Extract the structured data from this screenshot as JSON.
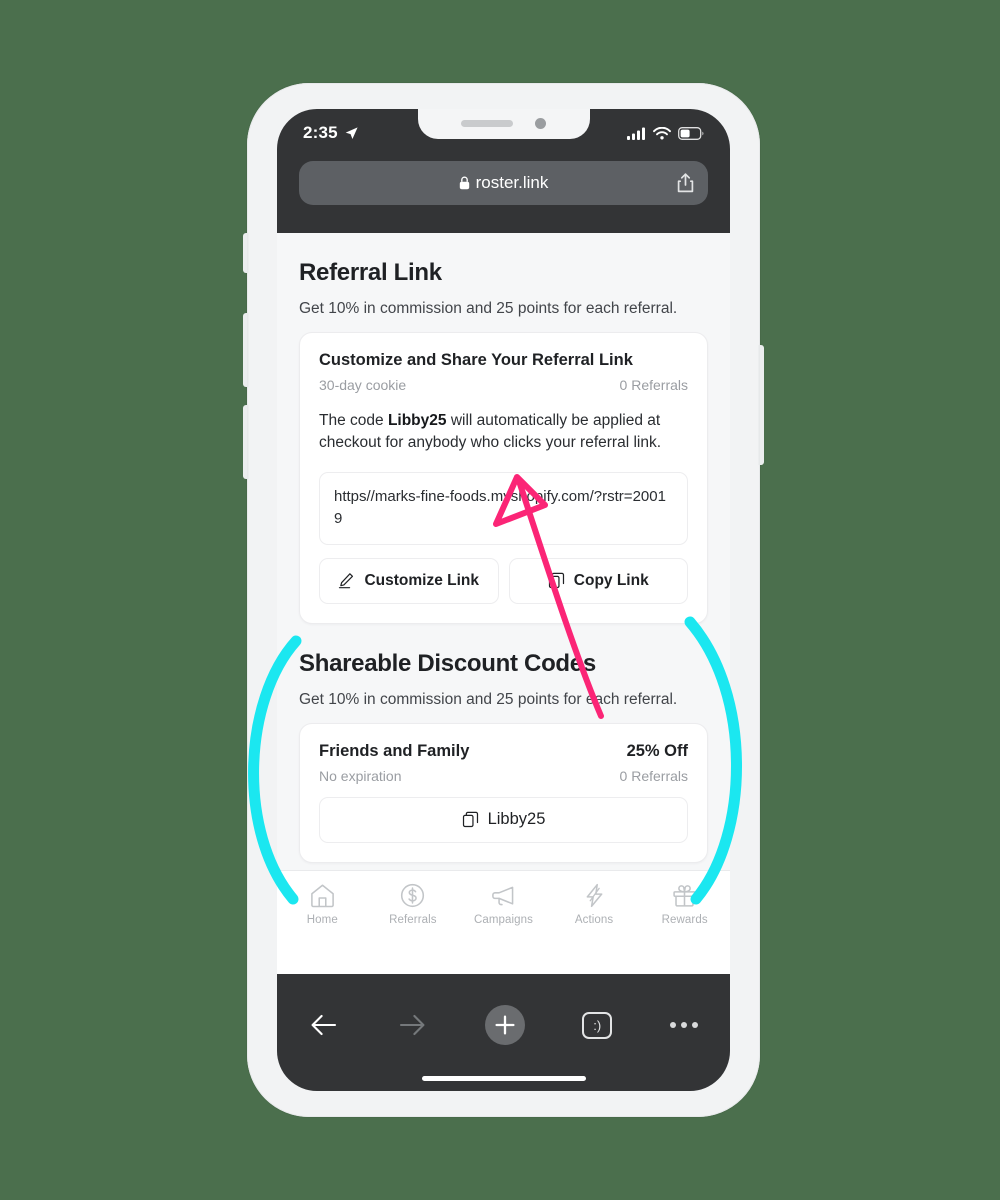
{
  "device": {
    "status_bar": {
      "time": "2:35",
      "location_icon": "location-arrow-icon",
      "signal_icon": "cellular-signal-icon",
      "wifi_icon": "wifi-icon",
      "battery_icon": "battery-icon"
    },
    "url_bar": {
      "lock_icon": "lock-icon",
      "domain": "roster.link",
      "share_icon": "share-icon"
    },
    "browser_toolbar": {
      "back_icon": "back-arrow-icon",
      "forward_icon": "forward-arrow-icon",
      "new_tab_icon": "plus-icon",
      "tabs_icon": "smiley-tab-icon",
      "tabs_label": ":)",
      "more_icon": "more-dots-icon"
    }
  },
  "page": {
    "referral_link": {
      "title": "Referral Link",
      "subtitle": "Get 10% in commission and 25 points for each referral.",
      "card": {
        "title": "Customize and Share Your Referral Link",
        "cookie": "30-day cookie",
        "referrals": "0 Referrals",
        "body_prefix": "The code ",
        "body_code": "Libby25",
        "body_suffix": " will automatically be applied at checkout for anybody who clicks your referral link.",
        "url": "https//marks-fine-foods.myshopify.com/?rstr=20019",
        "customize_button": "Customize Link",
        "customize_icon": "pencil-edit-icon",
        "copy_button": "Copy Link",
        "copy_icon": "copy-icon"
      }
    },
    "discount_codes": {
      "title": "Shareable Discount Codes",
      "subtitle": "Get 10% in commission and 25 points for each referral.",
      "card": {
        "name": "Friends and Family",
        "discount": "25% Off",
        "expiration": "No expiration",
        "referrals": "0 Referrals",
        "code": "Libby25",
        "code_icon": "copy-icon"
      }
    }
  },
  "tabbar": {
    "items": [
      {
        "label": "Home",
        "icon": "home-icon"
      },
      {
        "label": "Referrals",
        "icon": "dollar-circle-icon"
      },
      {
        "label": "Campaigns",
        "icon": "megaphone-icon"
      },
      {
        "label": "Actions",
        "icon": "lightning-bolt-icon"
      },
      {
        "label": "Rewards",
        "icon": "gift-icon"
      }
    ]
  },
  "annotations": {
    "arrow_color": "#FB2576",
    "arc_color": "#1BE7F0",
    "arrow_name": "pink-callout-arrow",
    "left_arc_name": "cyan-left-bracket-arc",
    "right_arc_name": "cyan-right-bracket-arc"
  },
  "theme": {
    "background": "#4b6f4d",
    "frame": "#f2f3f4",
    "chrome": "#333436",
    "page_bg": "#f6f7f8",
    "card_bg": "#ffffff",
    "text": "#1f2124",
    "muted": "#9a9da2"
  }
}
